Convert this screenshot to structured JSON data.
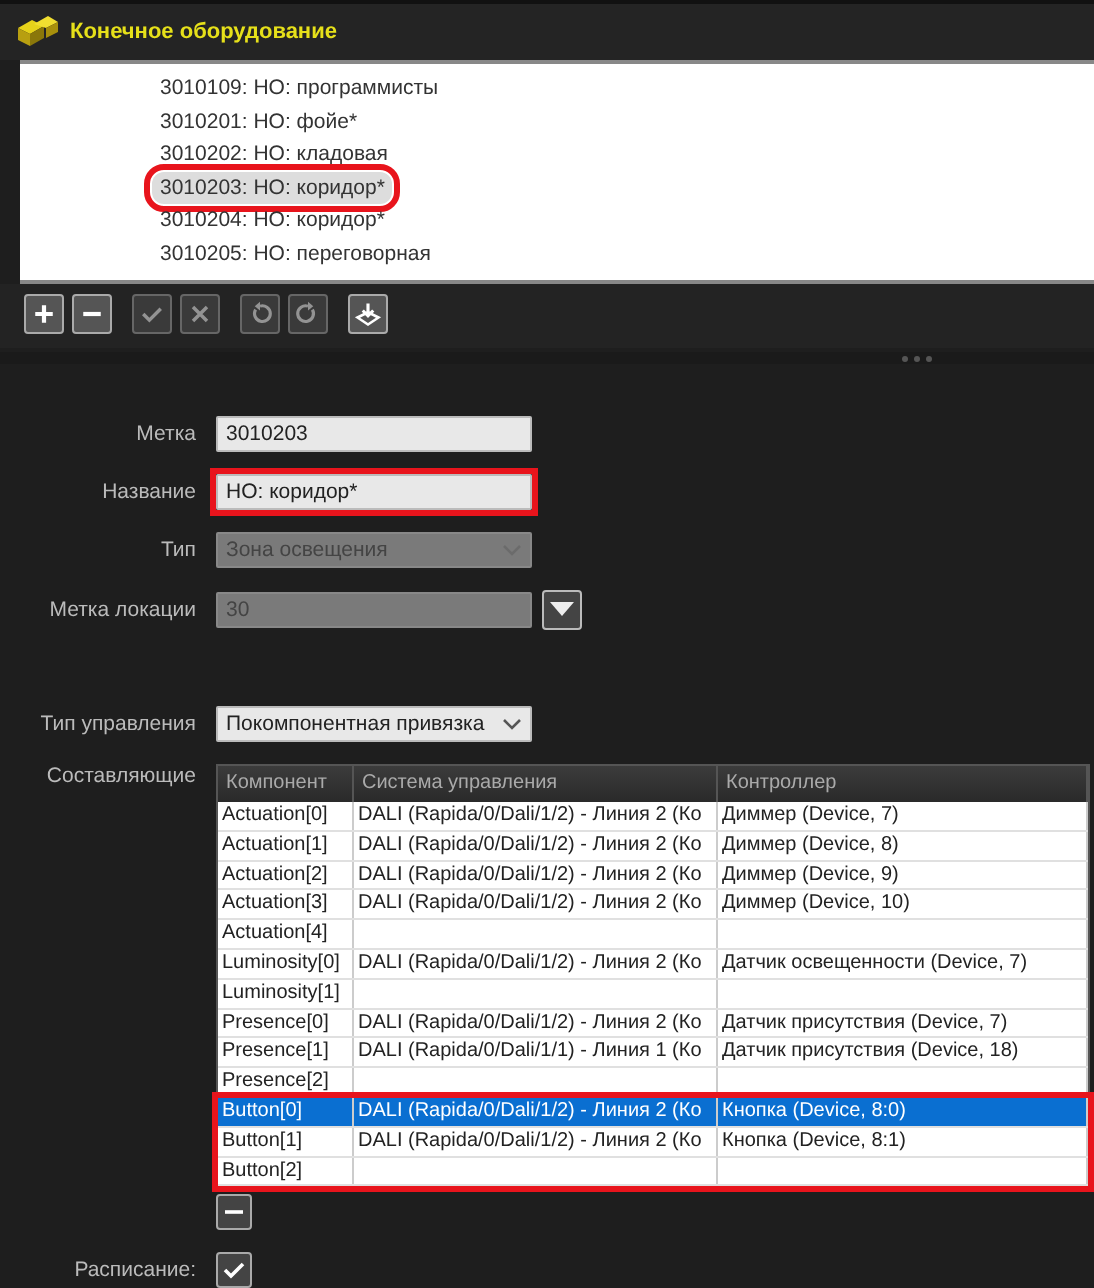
{
  "window": {
    "title": "Конечное оборудование"
  },
  "list": {
    "items": [
      {
        "label": "3010109: НО: программисты",
        "selected": false,
        "highlighted": false
      },
      {
        "label": "3010201: НО: фойе*",
        "selected": false,
        "highlighted": false
      },
      {
        "label": "3010202: НО: кладовая",
        "selected": false,
        "highlighted": false
      },
      {
        "label": "3010203: НО: коридор*",
        "selected": true,
        "highlighted": true
      },
      {
        "label": "3010204: НО: коридор*",
        "selected": false,
        "highlighted": false
      },
      {
        "label": "3010205: НО: переговорная",
        "selected": false,
        "highlighted": false
      }
    ]
  },
  "toolbar": [
    {
      "kind": "add",
      "disabled": false
    },
    {
      "kind": "remove",
      "disabled": false
    },
    {
      "kind": "apply",
      "disabled": true
    },
    {
      "kind": "cancel",
      "disabled": true
    },
    {
      "kind": "undo",
      "disabled": true
    },
    {
      "kind": "redo",
      "disabled": true
    },
    {
      "kind": "import",
      "disabled": false
    }
  ],
  "form": {
    "fields": [
      {
        "label": "Метка",
        "kind": "text",
        "value": "3010203",
        "disabled": false,
        "highlighted": false
      },
      {
        "label": "Название",
        "kind": "text",
        "value": "НО: коридор*",
        "disabled": false,
        "highlighted": true
      },
      {
        "label": "Тип",
        "kind": "select",
        "value": "Зона освещения",
        "disabled": true,
        "highlighted": false
      },
      {
        "label": "Метка локации",
        "kind": "picker",
        "value": "30",
        "disabled": true,
        "highlighted": false
      },
      {
        "label": "Тип управления",
        "kind": "select",
        "value": "Покомпонентная привязка",
        "disabled": false,
        "highlighted": false
      }
    ]
  },
  "components": {
    "label": "Составляющие",
    "columns": [
      "Компонент",
      "Система управления",
      "Контроллер"
    ],
    "rows": [
      {
        "cells": [
          "Actuation[0]",
          "DALI (Rapida/0/Dali/1/2) - Линия 2 (Ко",
          "Диммер (Device, 7)"
        ],
        "selected": false,
        "highlighted": false
      },
      {
        "cells": [
          "Actuation[1]",
          "DALI (Rapida/0/Dali/1/2) - Линия 2 (Ко",
          "Диммер (Device, 8)"
        ],
        "selected": false,
        "highlighted": false
      },
      {
        "cells": [
          "Actuation[2]",
          "DALI (Rapida/0/Dali/1/2) - Линия 2 (Ко",
          "Диммер (Device, 9)"
        ],
        "selected": false,
        "highlighted": false
      },
      {
        "cells": [
          "Actuation[3]",
          "DALI (Rapida/0/Dali/1/2) - Линия 2 (Ко",
          "Диммер (Device, 10)"
        ],
        "selected": false,
        "highlighted": false
      },
      {
        "cells": [
          "Actuation[4]",
          "",
          ""
        ],
        "selected": false,
        "highlighted": false
      },
      {
        "cells": [
          "Luminosity[0]",
          "DALI (Rapida/0/Dali/1/2) - Линия 2 (Ко",
          "Датчик освещенности (Device, 7)"
        ],
        "selected": false,
        "highlighted": false
      },
      {
        "cells": [
          "Luminosity[1]",
          "",
          ""
        ],
        "selected": false,
        "highlighted": false
      },
      {
        "cells": [
          "Presence[0]",
          "DALI (Rapida/0/Dali/1/2) - Линия 2 (Ко",
          "Датчик присутствия (Device, 7)"
        ],
        "selected": false,
        "highlighted": false
      },
      {
        "cells": [
          "Presence[1]",
          "DALI (Rapida/0/Dali/1/1) - Линия 1 (Ко",
          "Датчик присутствия (Device, 18)"
        ],
        "selected": false,
        "highlighted": false
      },
      {
        "cells": [
          "Presence[2]",
          "",
          ""
        ],
        "selected": false,
        "highlighted": false
      },
      {
        "cells": [
          "Button[0]",
          "DALI (Rapida/0/Dali/1/2) - Линия 2 (Ко",
          "Кнопка (Device, 8:0)"
        ],
        "selected": true,
        "highlighted": true
      },
      {
        "cells": [
          "Button[1]",
          "DALI (Rapida/0/Dali/1/2) - Линия 2 (Ко",
          "Кнопка (Device, 8:1)"
        ],
        "selected": false,
        "highlighted": true
      },
      {
        "cells": [
          "Button[2]",
          "",
          ""
        ],
        "selected": false,
        "highlighted": true
      }
    ]
  },
  "schedule": {
    "label": "Расписание:",
    "checked": true
  }
}
